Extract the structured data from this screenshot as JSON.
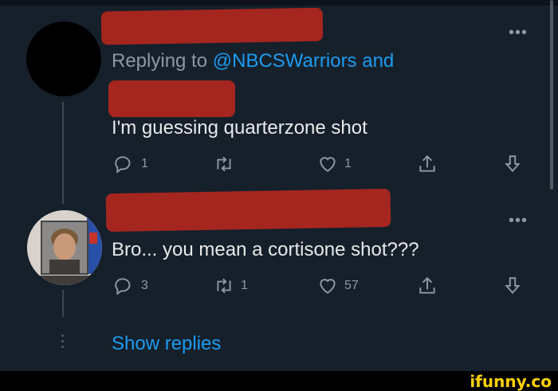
{
  "tweet1": {
    "replying_prefix": "Replying to",
    "replying_handle": "@NBCSWarriors",
    "replying_suffix": "and",
    "text": "I'm guessing quarterzone shot",
    "actions": {
      "reply_count": "1",
      "retweet_count": "",
      "like_count": "1"
    }
  },
  "tweet2": {
    "text": "Bro... you mean a cortisone shot???",
    "actions": {
      "reply_count": "3",
      "retweet_count": "1",
      "like_count": "57"
    }
  },
  "show_replies": "Show replies",
  "more_label": "•••",
  "watermark": "ifunny.co",
  "colors": {
    "background": "#15202b",
    "accent": "#1d9bf0",
    "muted": "#8b98a5",
    "redaction": "#b1271e"
  }
}
